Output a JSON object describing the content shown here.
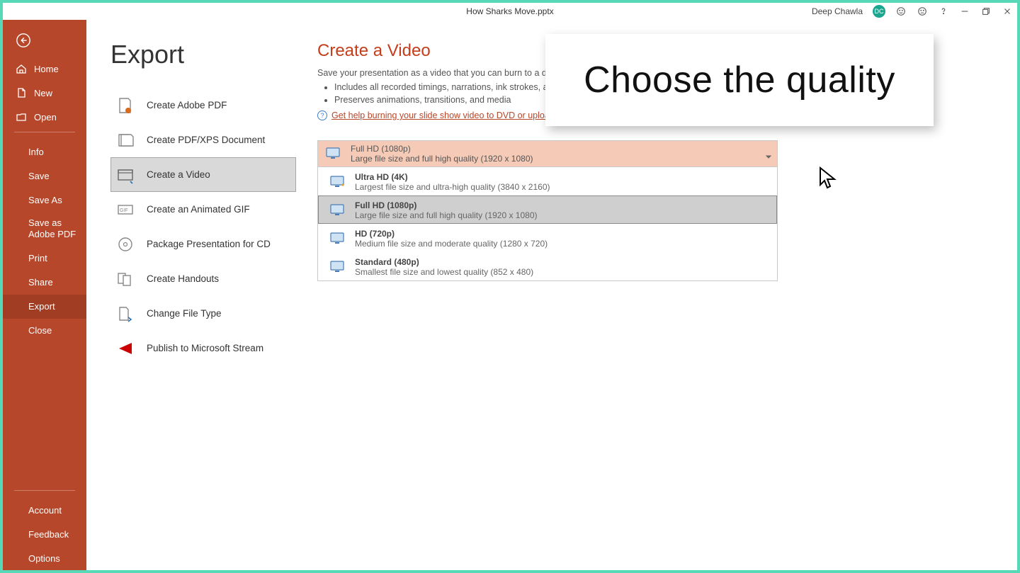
{
  "titlebar": {
    "title": "How Sharks Move.pptx",
    "user_name": "Deep Chawla",
    "user_initials": "DC"
  },
  "sidebar": {
    "items_top": [
      {
        "id": "home",
        "label": "Home"
      },
      {
        "id": "new",
        "label": "New"
      },
      {
        "id": "open",
        "label": "Open"
      }
    ],
    "items_mid": [
      {
        "id": "info",
        "label": "Info"
      },
      {
        "id": "save",
        "label": "Save"
      },
      {
        "id": "saveas",
        "label": "Save As"
      },
      {
        "id": "savepdf",
        "label": "Save as Adobe PDF"
      },
      {
        "id": "print",
        "label": "Print"
      },
      {
        "id": "share",
        "label": "Share"
      },
      {
        "id": "export",
        "label": "Export"
      },
      {
        "id": "close",
        "label": "Close"
      }
    ],
    "items_bottom": [
      {
        "id": "account",
        "label": "Account"
      },
      {
        "id": "feedback",
        "label": "Feedback"
      },
      {
        "id": "options",
        "label": "Options"
      }
    ]
  },
  "export": {
    "title": "Export",
    "items": [
      {
        "id": "adobe",
        "label": "Create Adobe PDF"
      },
      {
        "id": "pdfxps",
        "label": "Create PDF/XPS Document"
      },
      {
        "id": "video",
        "label": "Create a Video"
      },
      {
        "id": "gif",
        "label": "Create an Animated GIF"
      },
      {
        "id": "cd",
        "label": "Package Presentation for CD"
      },
      {
        "id": "handouts",
        "label": "Create Handouts"
      },
      {
        "id": "filetype",
        "label": "Change File Type"
      },
      {
        "id": "stream",
        "label": "Publish to Microsoft Stream"
      }
    ]
  },
  "video": {
    "title": "Create a Video",
    "subtitle": "Save your presentation as a video that you can burn to a disc, upload to the web, or email",
    "bullets": [
      "Includes all recorded timings, narrations, ink strokes, and laser pointer gestures",
      "Preserves animations, transitions, and media"
    ],
    "help_text": "Get help burning your slide show video to DVD or uploading it to the web",
    "selected": {
      "title": "Full HD (1080p)",
      "desc": "Large file size and full high quality (1920 x 1080)"
    },
    "options": [
      {
        "id": "uhd",
        "title": "Ultra HD (4K)",
        "desc": "Largest file size and ultra-high quality (3840 x 2160)"
      },
      {
        "id": "fhd",
        "title": "Full HD (1080p)",
        "desc": "Large file size and full high quality (1920 x 1080)"
      },
      {
        "id": "hd",
        "title": "HD (720p)",
        "desc": "Medium file size and moderate quality (1280 x 720)"
      },
      {
        "id": "sd",
        "title": "Standard (480p)",
        "desc": "Smallest file size and lowest quality (852 x 480)"
      }
    ]
  },
  "overlay": {
    "text": "Choose the quality"
  }
}
